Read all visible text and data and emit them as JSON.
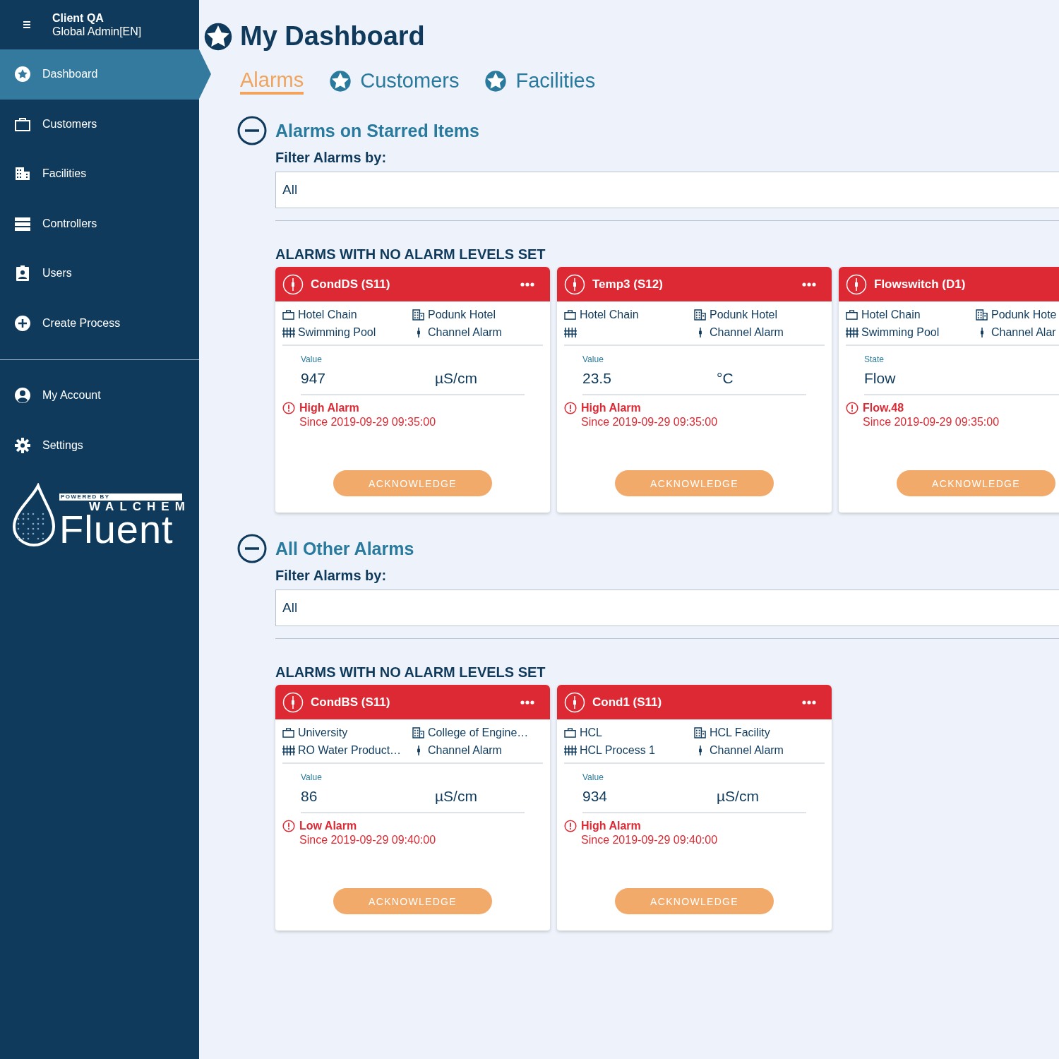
{
  "sidebar": {
    "account": {
      "name": "Client QA",
      "role": "Global Admin[EN]"
    },
    "items": [
      {
        "label": "Dashboard",
        "selected": true
      },
      {
        "label": "Customers",
        "selected": false
      },
      {
        "label": "Facilities",
        "selected": false
      },
      {
        "label": "Controllers",
        "selected": false
      },
      {
        "label": "Users",
        "selected": false
      },
      {
        "label": "Create Process",
        "selected": false
      }
    ],
    "bottom_items": [
      {
        "label": "My Account",
        "selected": false
      },
      {
        "label": "Settings",
        "selected": false
      }
    ],
    "logo": {
      "tagline": "POWERED BY",
      "brand": "WALCHEM",
      "product": "Fluent"
    }
  },
  "page": {
    "title": "My Dashboard",
    "tabs": [
      {
        "label": "Alarms",
        "selected": true,
        "starred": false
      },
      {
        "label": "Customers",
        "selected": false,
        "starred": true
      },
      {
        "label": "Facilities",
        "selected": false,
        "starred": true
      }
    ],
    "sections": [
      {
        "title": "Alarms on Starred Items",
        "expanded": true,
        "filter_label": "Filter Alarms by:",
        "filter_value": "All",
        "group_title": "ALARMS WITH NO ALARM LEVELS SET",
        "cards": [
          {
            "name": "CondDS (S11)",
            "menu": true,
            "customer": "Hotel Chain",
            "facility": "Podunk Hotel",
            "process": "Swimming Pool",
            "channel_type": "Channel Alarm",
            "kind": "value",
            "reading_label": "Value",
            "reading": "947",
            "unit": "µS/cm",
            "alarm": "High Alarm",
            "since": "Since 2019-09-29 09:35:00",
            "action": "ACKNOWLEDGE"
          },
          {
            "name": "Temp3 (S12)",
            "menu": true,
            "customer": "Hotel Chain",
            "facility": "Podunk Hotel",
            "channel_type": "Channel Alarm",
            "kind": "value",
            "reading_label": "Value",
            "reading": "23.5",
            "unit": "°C",
            "alarm": "High Alarm",
            "since": "Since 2019-09-29 09:35:00",
            "action": "ACKNOWLEDGE"
          },
          {
            "name": "Flowswitch (D1)",
            "menu": false,
            "customer": "Hotel Chain",
            "facility": "Podunk Hote",
            "process": "Swimming Pool",
            "channel_type": "Channel Alar",
            "kind": "state",
            "reading_label": "State",
            "reading": "Flow",
            "alarm": "Flow.48",
            "since": "Since 2019-09-29 09:35:00",
            "action": "ACKNOWLEDGE"
          }
        ]
      },
      {
        "title": "All Other Alarms",
        "expanded": true,
        "filter_label": "Filter Alarms by:",
        "filter_value": "All",
        "group_title": "ALARMS WITH NO ALARM LEVELS SET",
        "cards": [
          {
            "name": "CondBS (S11)",
            "menu": true,
            "customer": "University",
            "facility": "College of Engine…",
            "process": "RO Water Product…",
            "channel_type": "Channel Alarm",
            "kind": "value",
            "reading_label": "Value",
            "reading": "86",
            "unit": "µS/cm",
            "alarm": "Low Alarm",
            "since": "Since 2019-09-29 09:40:00",
            "action": "ACKNOWLEDGE"
          },
          {
            "name": "Cond1 (S11)",
            "menu": true,
            "customer": "HCL",
            "facility": "HCL Facility",
            "process": "HCL Process 1",
            "channel_type": "Channel Alarm",
            "kind": "value",
            "reading_label": "Value",
            "reading": "934",
            "unit": "µS/cm",
            "alarm": "High Alarm",
            "since": "Since 2019-09-29 09:40:00",
            "action": "ACKNOWLEDGE"
          }
        ]
      }
    ]
  }
}
